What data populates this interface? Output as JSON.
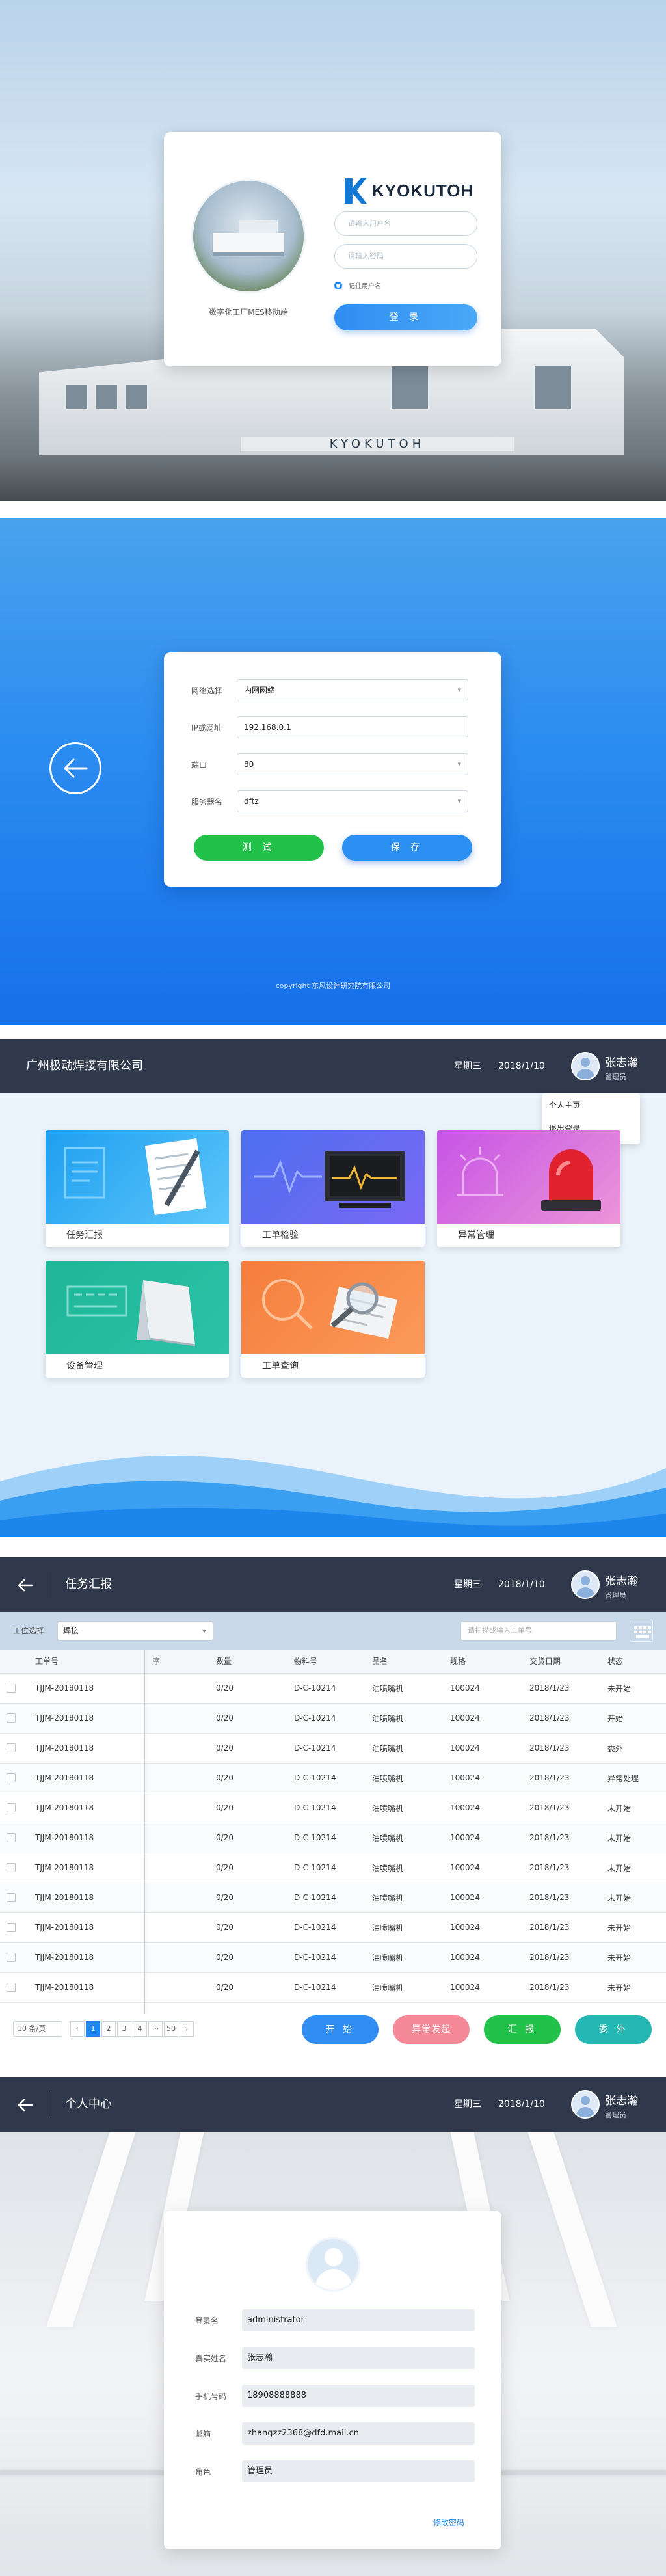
{
  "login": {
    "photo_caption": "数字化工厂MES移动端",
    "logo_text": "KYOKUTOH",
    "building_sign": "KYOKUTOH",
    "username_placeholder": "请输入用户名",
    "password_placeholder": "请输入密码",
    "remember_label": "记住用户名",
    "login_button": "登 录"
  },
  "settings": {
    "rows": [
      {
        "label": "网络选择",
        "value": "内网网络",
        "type": "select"
      },
      {
        "label": "IP或网址",
        "value": "192.168.0.1",
        "type": "input"
      },
      {
        "label": "端口",
        "value": "80",
        "type": "select"
      },
      {
        "label": "服务器名",
        "value": "dftz",
        "type": "select"
      }
    ],
    "test_button": "测 试",
    "save_button": "保 存",
    "copyright": "copyright 东风设计研究院有限公司"
  },
  "header": {
    "company": "广州极动焊接有限公司",
    "weekday": "星期三",
    "date": "2018/1/10",
    "user_name": "张志瀚",
    "user_role": "管理员"
  },
  "dashboard": {
    "menu": [
      "个人主页",
      "退出登录"
    ],
    "tiles": [
      {
        "label": "任务汇报",
        "color1": "#27a9f3",
        "color2": "#5cc3f9"
      },
      {
        "label": "工单检验",
        "color1": "#4c6ff0",
        "color2": "#7a68f4"
      },
      {
        "label": "异常管理",
        "color1": "#c653e6",
        "color2": "#e58bd6"
      },
      {
        "label": "设备管理",
        "color1": "#1fb597",
        "color2": "#2bc3a8"
      },
      {
        "label": "工单查询",
        "color1": "#f57d3c",
        "color2": "#fb9a5a"
      }
    ]
  },
  "task": {
    "title": "任务汇报",
    "filter_label": "工位选择",
    "filter_value": "焊接",
    "search_placeholder": "请扫描或输入工单号",
    "columns": [
      "工单号",
      "序",
      "数量",
      "物料号",
      "品名",
      "规格",
      "交货日期",
      "状态"
    ],
    "rows": [
      [
        "TJJM-20180118",
        "",
        "0/20",
        "D-C-10214",
        "油喷嘴机",
        "100024",
        "2018/1/23",
        "未开始"
      ],
      [
        "TJJM-20180118",
        "",
        "0/20",
        "D-C-10214",
        "油喷嘴机",
        "100024",
        "2018/1/23",
        "开始"
      ],
      [
        "TJJM-20180118",
        "",
        "0/20",
        "D-C-10214",
        "油喷嘴机",
        "100024",
        "2018/1/23",
        "委外"
      ],
      [
        "TJJM-20180118",
        "",
        "0/20",
        "D-C-10214",
        "油喷嘴机",
        "100024",
        "2018/1/23",
        "异常处理"
      ],
      [
        "TJJM-20180118",
        "",
        "0/20",
        "D-C-10214",
        "油喷嘴机",
        "100024",
        "2018/1/23",
        "未开始"
      ],
      [
        "TJJM-20180118",
        "",
        "0/20",
        "D-C-10214",
        "油喷嘴机",
        "100024",
        "2018/1/23",
        "未开始"
      ],
      [
        "TJJM-20180118",
        "",
        "0/20",
        "D-C-10214",
        "油喷嘴机",
        "100024",
        "2018/1/23",
        "未开始"
      ],
      [
        "TJJM-20180118",
        "",
        "0/20",
        "D-C-10214",
        "油喷嘴机",
        "100024",
        "2018/1/23",
        "未开始"
      ],
      [
        "TJJM-20180118",
        "",
        "0/20",
        "D-C-10214",
        "油喷嘴机",
        "100024",
        "2018/1/23",
        "未开始"
      ],
      [
        "TJJM-20180118",
        "",
        "0/20",
        "D-C-10214",
        "油喷嘴机",
        "100024",
        "2018/1/23",
        "未开始"
      ],
      [
        "TJJM-20180118",
        "",
        "0/20",
        "D-C-10214",
        "油喷嘴机",
        "100024",
        "2018/1/23",
        "未开始"
      ]
    ],
    "page_size": "10 条/页",
    "pages": [
      "1",
      "2",
      "3",
      "4",
      "···",
      "50"
    ],
    "current_page": "1",
    "actions": [
      {
        "label": "开 始",
        "color": "#2f8df2"
      },
      {
        "label": "异常发起",
        "color": "#f48a98"
      },
      {
        "label": "汇 报",
        "color": "#22c14a"
      },
      {
        "label": "委 外",
        "color": "#25b7b3"
      }
    ]
  },
  "profile": {
    "title": "个人中心",
    "fields": [
      {
        "label": "登录名",
        "value": "administrator"
      },
      {
        "label": "真实姓名",
        "value": "张志瀚"
      },
      {
        "label": "手机号码",
        "value": "18908888888"
      },
      {
        "label": "邮箱",
        "value": "zhangzz2368@dfd.mail.cn"
      },
      {
        "label": "角色",
        "value": "管理员"
      }
    ],
    "change_password": "修改密码"
  }
}
